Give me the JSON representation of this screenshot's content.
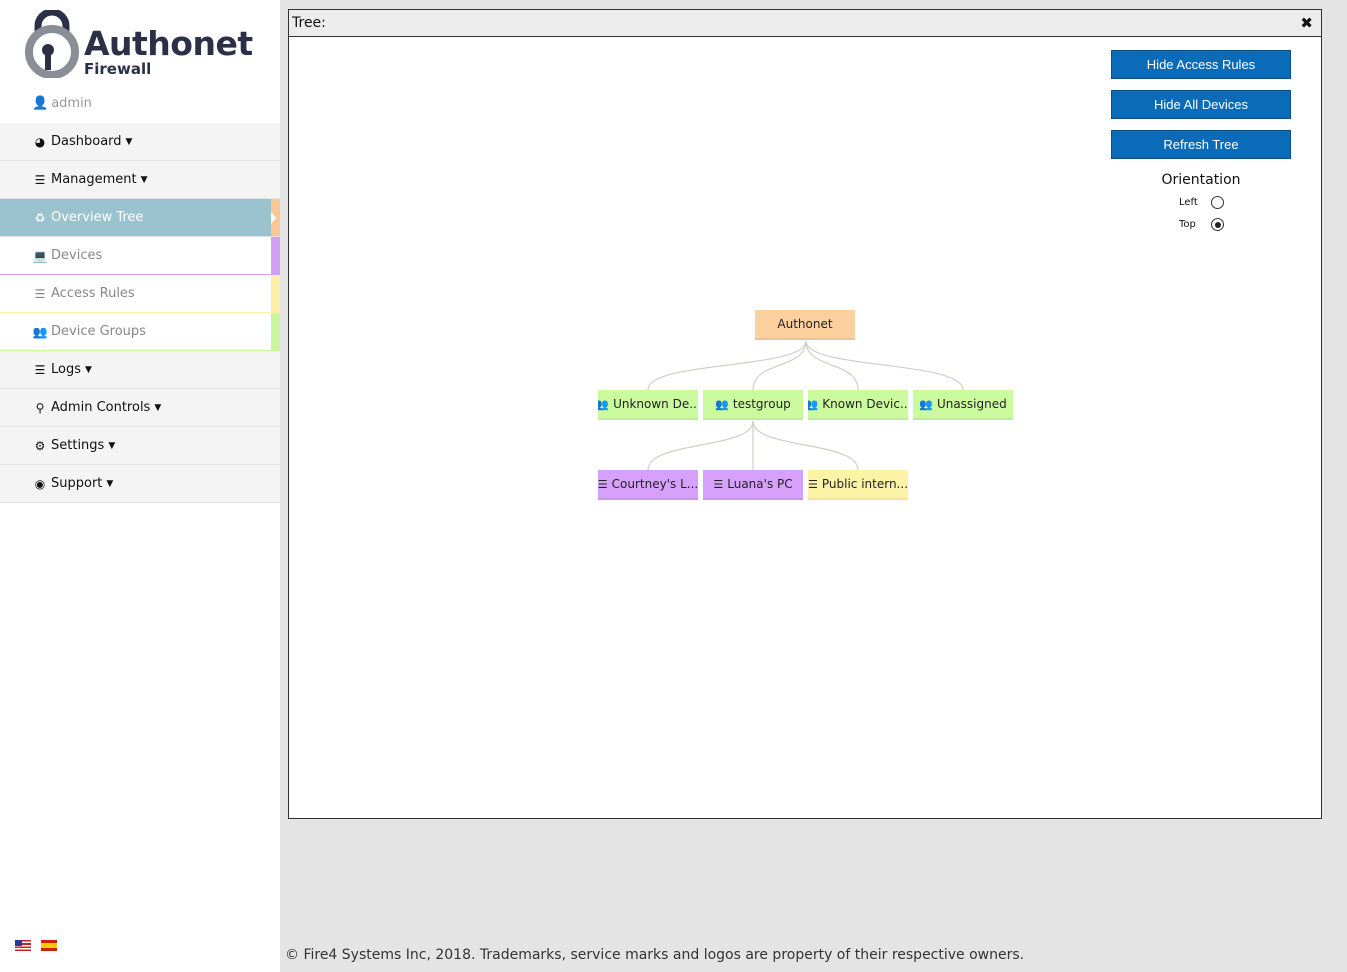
{
  "app": {
    "logo_text": "Authonet",
    "logo_sub": "Firewall"
  },
  "user": {
    "name": "admin",
    "icon": "user-icon"
  },
  "sidebar": {
    "items": [
      {
        "label": "Dashboard",
        "icon": "dashboard-icon"
      },
      {
        "label": "Management",
        "icon": "database-icon"
      },
      {
        "label": "Overview Tree",
        "icon": "sitemap-icon",
        "active": true,
        "accent": "#f9c894"
      },
      {
        "label": "Devices",
        "icon": "laptop-icon",
        "accent": "#cfa0f5"
      },
      {
        "label": "Access Rules",
        "icon": "database-icon",
        "accent": "#fdf0a6"
      },
      {
        "label": "Device Groups",
        "icon": "users-icon",
        "accent": "#c9f59c"
      },
      {
        "label": "Logs",
        "icon": "list-icon"
      },
      {
        "label": "Admin Controls",
        "icon": "key-icon"
      },
      {
        "label": "Settings",
        "icon": "gear-icon"
      },
      {
        "label": "Support",
        "icon": "lifebuoy-icon"
      }
    ]
  },
  "panel": {
    "title": "Tree:",
    "close_icon": "close-icon",
    "buttons": {
      "hide_access_rules": "Hide Access Rules",
      "hide_all_devices": "Hide All Devices",
      "refresh_tree": "Refresh Tree"
    },
    "orientation": {
      "title": "Orientation",
      "options": [
        {
          "label": "Left",
          "selected": false
        },
        {
          "label": "Top",
          "selected": true
        }
      ]
    }
  },
  "tree": {
    "root": {
      "label": "Authonet",
      "color": "#fdd09e"
    },
    "groups": [
      {
        "label": "Unknown De...",
        "icon": "users-icon",
        "color": "#ccfb9f"
      },
      {
        "label": "testgroup",
        "icon": "users-icon",
        "color": "#ccfb9f"
      },
      {
        "label": "Known Devic...",
        "icon": "users-icon",
        "color": "#ccfb9f"
      },
      {
        "label": "Unassigned",
        "icon": "users-icon",
        "color": "#ccfb9f"
      }
    ],
    "children": [
      {
        "label": "Courtney's L...",
        "icon": "database-icon",
        "color": "#d6a0fb"
      },
      {
        "label": "Luana's PC",
        "icon": "database-icon",
        "color": "#d6a0fb"
      },
      {
        "label": "Public intern...",
        "icon": "database-icon",
        "color": "#fdf3a6"
      }
    ]
  },
  "footer": {
    "text": "© Fire4 Systems Inc, 2018. Trademarks, service marks and logos are property of their respective owners."
  },
  "languages": [
    "us-flag-icon",
    "es-flag-icon"
  ]
}
